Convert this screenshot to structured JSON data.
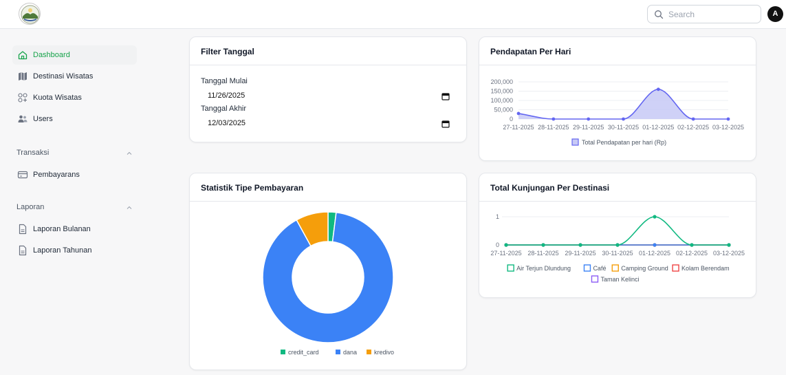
{
  "header": {
    "search_placeholder": "Search",
    "avatar_initial": "A"
  },
  "sidebar": {
    "items": [
      {
        "label": "Dashboard",
        "icon": "home-icon",
        "active": true
      },
      {
        "label": "Destinasi Wisatas",
        "icon": "map-icon"
      },
      {
        "label": "Kuota Wisatas",
        "icon": "grid-plus-icon"
      },
      {
        "label": "Users",
        "icon": "users-icon"
      }
    ],
    "sections": [
      {
        "title": "Transaksi",
        "items": [
          {
            "label": "Pembayarans",
            "icon": "card-icon"
          }
        ]
      },
      {
        "title": "Laporan",
        "items": [
          {
            "label": "Laporan Bulanan",
            "icon": "document-icon"
          },
          {
            "label": "Laporan Tahunan",
            "icon": "document-icon"
          }
        ]
      }
    ]
  },
  "filter": {
    "title": "Filter Tanggal",
    "start_label": "Tanggal Mulai",
    "start_value": "11/26/2025",
    "end_label": "Tanggal Akhir",
    "end_value": "12/03/2025"
  },
  "revenue": {
    "title": "Pendapatan Per Hari"
  },
  "payment": {
    "title": "Statistik Tipe Pembayaran"
  },
  "visits": {
    "title": "Total Kunjungan Per Destinasi"
  },
  "colors": {
    "primary_green": "#16a34a",
    "revenue_line": "#6366f1",
    "revenue_fill": "#c7c9f6",
    "credit_card": "#10b981",
    "dana": "#3b82f6",
    "kredivo": "#f59e0b"
  },
  "chart_data": [
    {
      "type": "area",
      "categories": [
        "27-11-2025",
        "28-11-2025",
        "29-11-2025",
        "30-11-2025",
        "01-12-2025",
        "02-12-2025",
        "03-12-2025"
      ],
      "series": [
        {
          "name": "Total Pendapatan per hari (Rp)",
          "values": [
            30000,
            0,
            0,
            0,
            160000,
            0,
            0
          ]
        }
      ],
      "ylim": [
        0,
        200000
      ],
      "yticks": [
        "0",
        "50,000",
        "100,000",
        "150,000",
        "200,000"
      ],
      "legend": "bottom",
      "grid": true
    },
    {
      "type": "pie",
      "donut": true,
      "categories": [
        "credit_card",
        "dana",
        "kredivo"
      ],
      "values": [
        2,
        90,
        8
      ],
      "legend": "bottom"
    },
    {
      "type": "line",
      "categories": [
        "27-11-2025",
        "28-11-2025",
        "29-11-2025",
        "30-11-2025",
        "01-12-2025",
        "02-12-2025",
        "03-12-2025"
      ],
      "series": [
        {
          "name": "Air Terjun Dlundung",
          "color": "#10b981",
          "values": [
            0,
            0,
            0,
            0,
            1,
            0,
            0
          ]
        },
        {
          "name": "Café",
          "color": "#3b82f6",
          "values": [
            0,
            0,
            0,
            0,
            0,
            0,
            0
          ]
        },
        {
          "name": "Camping Ground",
          "color": "#f59e0b",
          "values": [
            0,
            0,
            0,
            0,
            0,
            0,
            0
          ]
        },
        {
          "name": "Kolam Berendam",
          "color": "#ef4444",
          "values": [
            0,
            0,
            0,
            0,
            0,
            0,
            0
          ]
        },
        {
          "name": "Taman Kelinci",
          "color": "#8b5cf6",
          "values": [
            0,
            0,
            0,
            0,
            0,
            0,
            0
          ]
        }
      ],
      "ylim": [
        0,
        1
      ],
      "yticks": [
        "0",
        "1"
      ],
      "legend": "bottom",
      "grid": true
    }
  ]
}
